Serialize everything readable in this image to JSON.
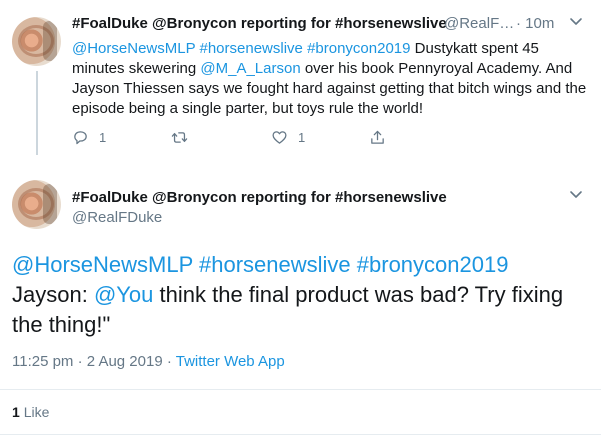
{
  "reply_tweet": {
    "display_name": "#FoalDuke @Bronycon reporting for #horsenewslive",
    "handle": "@RealF…",
    "separator": "·",
    "time": "10m",
    "text": [
      {
        "text": "@HorseNewsMLP",
        "link": true
      },
      {
        "text": " ",
        "link": false
      },
      {
        "text": "#horsenewslive",
        "link": true
      },
      {
        "text": " ",
        "link": false
      },
      {
        "text": "#bronycon2019",
        "link": true
      },
      {
        "text": " Dustykatt spent 45 minutes skewering ",
        "link": false
      },
      {
        "text": "@M_A_Larson",
        "link": true
      },
      {
        "text": " over his book Pennyroyal Academy. And Jayson Thiessen says we fought hard against getting that bitch wings and the episode being a single parter, but toys rule the  world!",
        "link": false
      }
    ],
    "actions": {
      "reply_icon": "reply-icon",
      "reply_count": "1",
      "retweet_icon": "retweet-icon",
      "retweet_count": "",
      "like_icon": "heart-icon",
      "like_count": "1",
      "share_icon": "share-icon"
    }
  },
  "main_tweet": {
    "display_name": "#FoalDuke @Bronycon reporting for #horsenewslive",
    "handle": "@RealFDuke",
    "text_line1": [
      {
        "text": "@HorseNewsMLP",
        "link": true
      },
      {
        "text": " ",
        "link": false
      },
      {
        "text": "#horsenewslive",
        "link": true
      },
      {
        "text": " ",
        "link": false
      },
      {
        "text": "#bronycon2019",
        "link": true
      }
    ],
    "text_line2": [
      {
        "text": "Jayson: ",
        "link": false
      },
      {
        "text": "@You",
        "link": true
      },
      {
        "text": " think the final product was bad? Try fixing the thing!\"",
        "link": false
      }
    ],
    "timestamp": "11:25 pm · 2 Aug 2019",
    "meta_separator": " · ",
    "source": "Twitter Web App",
    "likes_count": "1",
    "likes_label": "Like"
  },
  "colors": {
    "link": "#1b95e0",
    "muted": "#657786",
    "text": "#14171a",
    "divider": "#e6ecf0"
  }
}
